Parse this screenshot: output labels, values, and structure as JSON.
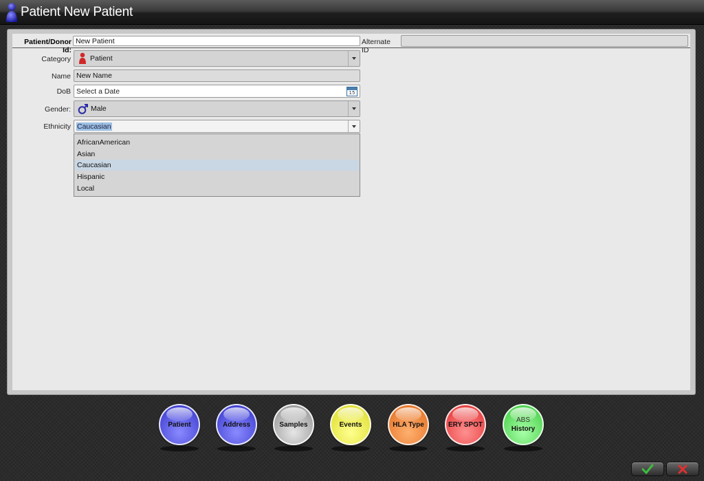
{
  "window": {
    "title": "Patient New Patient"
  },
  "form": {
    "patient_donor_id_label": "Patient/Donor Id:",
    "patient_donor_id_value": "New Patient",
    "alternate_id_label": "Alternate ID",
    "alternate_id_value": "",
    "category_label": "Category",
    "category_value": "Patient",
    "name_label": "Name",
    "name_value": "New Name",
    "dob_label": "DoB",
    "dob_placeholder": "Select a Date",
    "calendar_day": "15",
    "gender_label": "Gender:",
    "gender_value": "Male",
    "ethnicity_label": "Ethnicity",
    "ethnicity_value": "Caucasian",
    "ethnicity_options": [
      "AfricanAmerican",
      "Asian",
      "Caucasian",
      "Hispanic",
      "Local"
    ],
    "ethnicity_selected_index": 2
  },
  "tabs": [
    {
      "label": "Patient",
      "color": "#5858e8"
    },
    {
      "label": "Address",
      "color": "#5858e8"
    },
    {
      "label": "Samples",
      "color": "#b0b0b0"
    },
    {
      "label": "Events",
      "color": "#f0f050"
    },
    {
      "label": "HLA Type",
      "color": "#f08838"
    },
    {
      "label": "ERY SPOT",
      "color": "#f05a5a"
    },
    {
      "label": "History",
      "sub": "ABS",
      "color": "#62e062"
    }
  ],
  "actions": {
    "ok_icon": "check-icon",
    "cancel_icon": "x-icon"
  },
  "colors": {
    "patient_icon": "#d02828",
    "male_icon": "#2a2aa8",
    "ok": "#3cbf3c",
    "cancel": "#e03030"
  }
}
